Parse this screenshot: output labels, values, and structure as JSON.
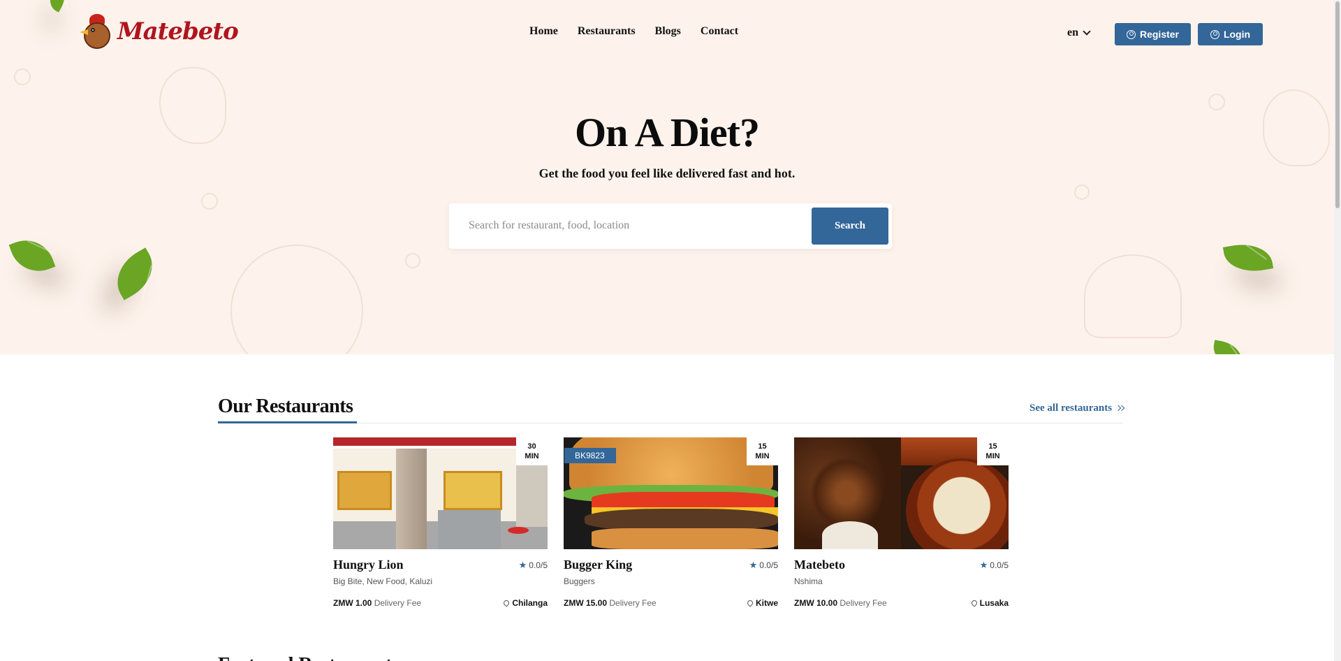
{
  "brand": {
    "name": "Matebeto"
  },
  "nav": {
    "items": [
      {
        "label": "Home"
      },
      {
        "label": "Restaurants"
      },
      {
        "label": "Blogs"
      },
      {
        "label": "Contact"
      }
    ]
  },
  "language": {
    "selected": "en"
  },
  "auth": {
    "register_label": "Register",
    "login_label": "Login"
  },
  "hero": {
    "title": "On A Diet?",
    "subtitle": "Get the food you feel like delivered fast and hot.",
    "search_placeholder": "Search for restaurant, food, location",
    "search_button": "Search"
  },
  "restaurants": {
    "title": "Our Restaurants",
    "see_all_label": "See all restaurants",
    "delivery_fee_label": "Delivery Fee",
    "items": [
      {
        "name": "Hungry Lion",
        "time_value": "30",
        "time_unit": "MIN",
        "rating": "0.0/5",
        "categories": "Big Bite, New Food, Kaluzi",
        "fee": "ZMW 1.00",
        "location": "Chilanga",
        "tag": ""
      },
      {
        "name": "Bugger King",
        "time_value": "15",
        "time_unit": "MIN",
        "rating": "0.0/5",
        "categories": "Buggers",
        "fee": "ZMW 15.00",
        "location": "Kitwe",
        "tag": "BK9823"
      },
      {
        "name": "Matebeto",
        "time_value": "15",
        "time_unit": "MIN",
        "rating": "0.0/5",
        "categories": "Nshima",
        "fee": "ZMW 10.00",
        "location": "Lusaka",
        "tag": ""
      }
    ]
  },
  "next_section": {
    "title": "Featured Restaurants"
  },
  "colors": {
    "accent": "#336699",
    "hero_bg": "#fdf3ec",
    "brand_red": "#b0141e"
  }
}
